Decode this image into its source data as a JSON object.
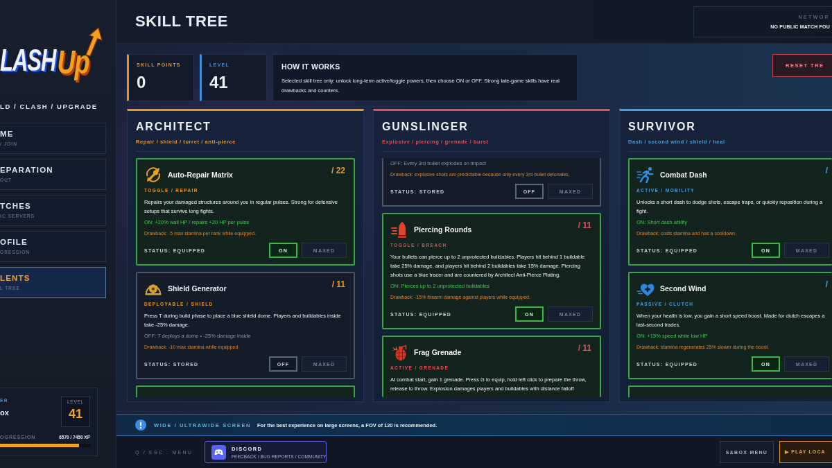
{
  "sidebar": {
    "logo": {
      "text": "LASH",
      "accent": "Up"
    },
    "tagline": "LD / CLASH / UPGRADE",
    "nav": [
      {
        "title": "ME",
        "subtitle": "/ JOIN",
        "selected": false
      },
      {
        "title": "EPARATION",
        "subtitle": "OUT",
        "selected": false
      },
      {
        "title": "TCHES",
        "subtitle": "IC SERVERS",
        "selected": false
      },
      {
        "title": "OFILE",
        "subtitle": "GRESSION",
        "selected": false
      },
      {
        "title": "LENTS",
        "subtitle": "L TREE",
        "selected": true
      }
    ],
    "player": {
      "label": "ER",
      "name": "ox",
      "level_label": "LEVEL",
      "level_value": "41",
      "progress": {
        "label": "OGRESSION",
        "reading": "6570 / 7450 XP",
        "level": 0.88
      }
    }
  },
  "header": {
    "title": "SKILL TREE",
    "network": {
      "label": "NETWOR",
      "status": "NO PUBLIC MATCH FOU"
    }
  },
  "stats": [
    {
      "label": "SKILL POINTS",
      "value": "0",
      "color": "#e8962a"
    },
    {
      "label": "LEVEL",
      "value": "41",
      "color": "#3f8fe0"
    }
  ],
  "how_it_works": {
    "title": "HOW IT WORKS",
    "text": "Selected skill tree only: unlock long-term active/toggle powers, then choose ON or OFF. Strong late-game skills have real drawbacks and counters."
  },
  "reset_button": "RESET TRE",
  "columns": [
    {
      "name": "ARCHITECT",
      "subtitle": "Repair / shield / turret / anti-pierce",
      "color": "#e8962a",
      "cards": [
        {
          "title": "Auto-Repair Matrix",
          "rank": "/ 22",
          "tag": "TOGGLE / REPAIR",
          "description": [
            "Repairs your damaged structures around you in regular pulses. Strong for defensive setups that survive long fights."
          ],
          "effect": "ON: +20% wall HP / repairs +20 HP per pulse",
          "drawback": "Drawback: -5 max stamina per rank while equipped.",
          "status": "STATUS: EQUIPPED",
          "equipped": true,
          "toggle": "ON",
          "maxed": {
            "label": "MAXED",
            "disabled": true
          }
        },
        {
          "title": "Shield Generator",
          "rank": "/ 11",
          "tag": "DEPLOYABLE / SHIELD",
          "description": [
            "Press T during build phase to place a blue shield dome. Players and buildables inside take -25% damage."
          ],
          "effect": "OFF: T deploys a dome • -25% damage inside",
          "drawback": "Drawback: -10 max stamina while equipped.",
          "status": "STATUS: STORED",
          "equipped": false,
          "toggle": "OFF",
          "maxed": {
            "label": "MAXED",
            "disabled": true
          }
        },
        {
          "equipped": true
        }
      ]
    },
    {
      "name": "GUNSLINGER",
      "subtitle": "Explosive / piercing / grenade / burst",
      "color": "#e0505a",
      "cards": [
        {
          "effect": "OFF: Every 3rd bullet explodes on impact",
          "drawback": "Drawback: explosive shots are predictable because only every 3rd bullet detonates.",
          "status": "STATUS: STORED",
          "equipped": false,
          "toggle": "OFF",
          "maxed": {
            "label": "MAXED",
            "disabled": true
          }
        },
        {
          "title": "Piercing Rounds",
          "rank": "/ 11",
          "tag": "TOGGLE / BREACH",
          "description": [
            "Your bullets can pierce up to 2 unprotected buildables. Players hit behind 1 buildable take 25% damage, and players hit behind 2 buildables take 15% damage. Piercing shots use a blue tracer and are countered by Architect Anti-Pierce Plating."
          ],
          "effect": "ON: Pierces up to 2 unprotected buildables",
          "drawback": "Drawback: -15% firearm damage against players while equipped.",
          "status": "STATUS: EQUIPPED",
          "equipped": true,
          "toggle": "ON",
          "maxed": {
            "label": "MAXED",
            "disabled": true
          }
        },
        {
          "title": "Frag Grenade",
          "rank": "/ 11",
          "tag": "ACTIVE / GRENADE",
          "description": [
            "At combat start, gain 1 grenade. Press G to equip, hold left click to prepare the throw, release to throw. Explosion damages players and buildables with distance falloff"
          ],
          "equipped": true
        }
      ]
    },
    {
      "name": "SURVIVOR",
      "subtitle": "Dash / second wind / shield / heal",
      "color": "#4a9fd8",
      "cards": [
        {
          "title": "Combat Dash",
          "rank": "/",
          "tag": "ACTIVE / MOBILITY",
          "description": [
            "Unlocks a short dash to dodge shots, escape traps, or quickly reposition during a fight."
          ],
          "effect": "ON: Short dash ability",
          "drawback": "Drawback: costs stamina and has a cooldown.",
          "status": "STATUS: EQUIPPED",
          "equipped": true,
          "toggle": "ON",
          "maxed": {
            "label": "MAXED",
            "disabled": true
          }
        },
        {
          "title": "Second Wind",
          "rank": "/",
          "tag": "PASSIVE / CLUTCH",
          "description": [
            "When your health is low, you gain a short speed boost. Made for clutch escapes a",
            "last-second trades."
          ],
          "effect": "ON: +15% speed while low HP",
          "drawback": "Drawback: stamina regenerates 25% slower during the boost.",
          "status": "STATUS: EQUIPPED",
          "equipped": true,
          "toggle": "ON",
          "maxed": {
            "label": "MAXED",
            "disabled": true
          }
        },
        {
          "equipped": true
        }
      ]
    }
  ],
  "banner": {
    "title": "WIDE / ULTRAWIDE SCREEN",
    "text": "For the best experience on large screens, a FOV of 120 is recommended."
  },
  "footer": {
    "hint": "Q / ESC : MENU",
    "discord": {
      "title": "DISCORD",
      "subtitle": "FEEDBACK / BUG REPORTS / COMMUNITY"
    },
    "buttons": [
      {
        "label": "S&BOX MENU",
        "kind": "secondary"
      },
      {
        "label": "▶ PLAY LOCA",
        "kind": "primary"
      }
    ]
  }
}
